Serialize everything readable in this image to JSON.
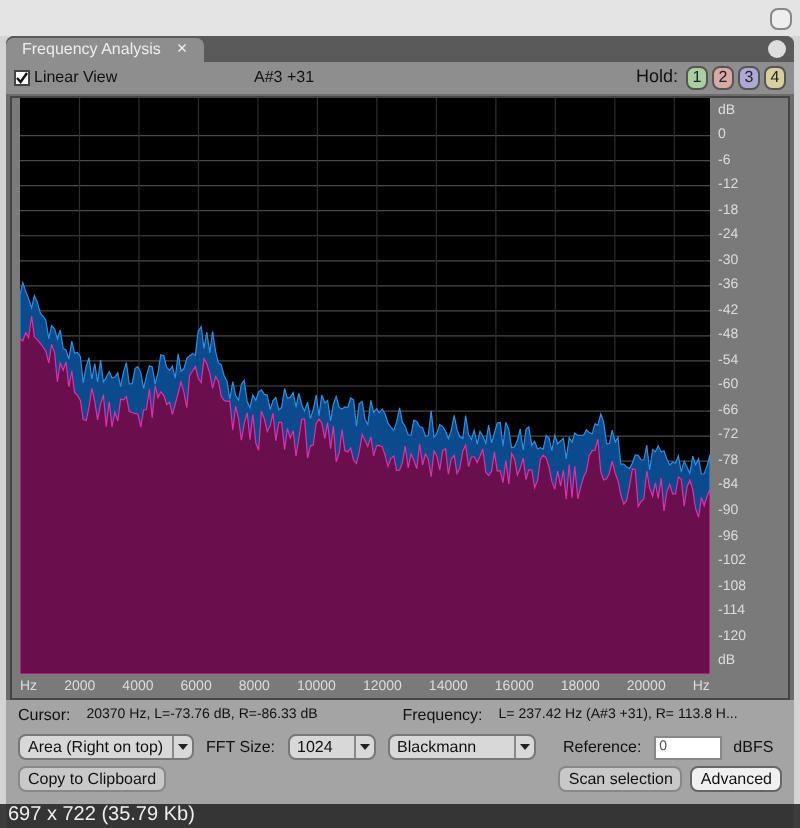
{
  "tab": {
    "label": "Frequency Analysis",
    "close": "×",
    "selected": true
  },
  "toolbar": {
    "linear_view": {
      "label": "Linear View",
      "checked": true
    },
    "note": "A#3 +31",
    "hold_label": "Hold:",
    "hold_buttons": [
      {
        "label": "1",
        "color": "#a9cfa0"
      },
      {
        "label": "2",
        "color": "#d9a9a6"
      },
      {
        "label": "3",
        "color": "#aea8d6"
      },
      {
        "label": "4",
        "color": "#d8cf9c"
      }
    ]
  },
  "y_axis_labels": [
    "dB",
    "0",
    "-6",
    "-12",
    "-18",
    "-24",
    "-30",
    "-36",
    "-42",
    "-48",
    "-54",
    "-60",
    "-66",
    "-72",
    "-78",
    "-84",
    "-90",
    "-96",
    "-102",
    "-108",
    "-114",
    "-120",
    "dB"
  ],
  "x_axis_labels": [
    "Hz",
    "2000",
    "4000",
    "6000",
    "8000",
    "10000",
    "12000",
    "14000",
    "16000",
    "18000",
    "20000",
    "Hz"
  ],
  "cursor": {
    "label": "Cursor:",
    "value": "20370 Hz, L=-73.76 dB, R=-86.33 dB"
  },
  "frequency": {
    "label": "Frequency:",
    "value": "L= 237.42 Hz (A#3 +31), R= 113.8 H..."
  },
  "controls": {
    "display_mode": "Area (Right on top)",
    "fft_label": "FFT Size:",
    "fft_size": "1024",
    "window": "Blackmann",
    "reference_label": "Reference:",
    "reference": "0",
    "reference_unit": "dBFS"
  },
  "buttons": [
    {
      "label": "Copy to Clipboard",
      "selected": false
    },
    {
      "label": "Scan selection",
      "selected": false
    },
    {
      "label": "Advanced",
      "selected": true
    }
  ],
  "image_info": "697 x 722 (35.79 Kb)"
}
